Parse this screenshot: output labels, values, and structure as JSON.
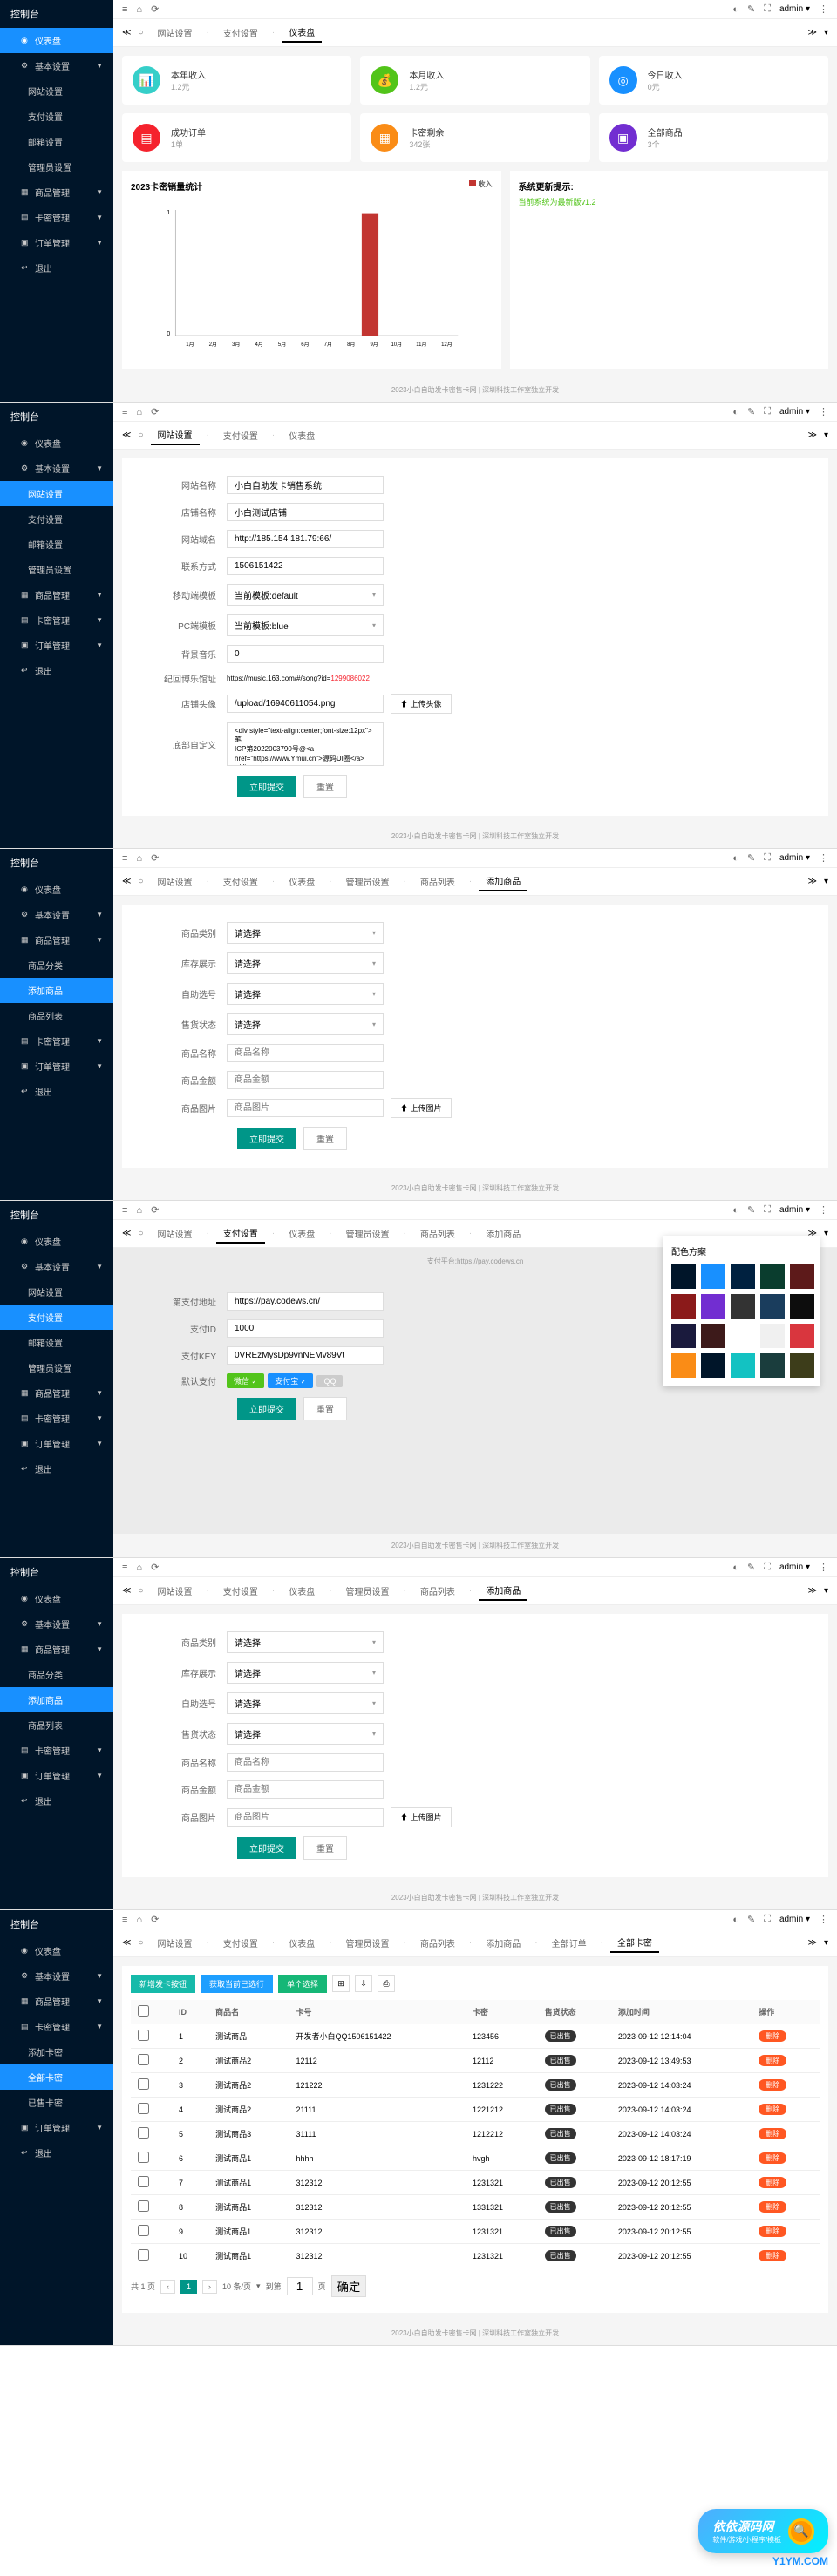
{
  "app_title": "控制台",
  "topbar": {
    "admin": "admin"
  },
  "sidebar": {
    "dashboard": "仪表盘",
    "basic_settings": "基本设置",
    "site_settings": "网站设置",
    "pay_settings": "支付设置",
    "mail_settings": "邮箱设置",
    "admin_settings": "管理员设置",
    "goods_mgmt": "商品管理",
    "goods_class": "商品分类",
    "add_goods": "添加商品",
    "goods_list": "商品列表",
    "card_mgmt": "卡密管理",
    "add_card": "添加卡密",
    "all_cards": "全部卡密",
    "sold_cards": "已售卡密",
    "order_mgmt": "订单管理",
    "logout": "退出"
  },
  "tabs": {
    "site": "网站设置",
    "pay": "支付设置",
    "dash": "仪表盘",
    "admin": "管理员设置",
    "goods": "商品列表",
    "add": "添加商品",
    "orders": "全部订单",
    "cards": "全部卡密"
  },
  "stats": {
    "year": {
      "label": "本年收入",
      "value": "1.2元"
    },
    "month": {
      "label": "本月收入",
      "value": "1.2元"
    },
    "today": {
      "label": "今日收入",
      "value": "0元"
    },
    "orders": {
      "label": "成功订单",
      "value": "1单"
    },
    "cards": {
      "label": "卡密剩余",
      "value": "342张"
    },
    "goods": {
      "label": "全部商品",
      "value": "3个"
    }
  },
  "chart": {
    "title": "2023卡密销量统计",
    "legend": "收入",
    "update_title": "系统更新提示:",
    "update_text": "当前系统为最新版v1.2"
  },
  "chart_data": {
    "type": "bar",
    "categories": [
      "1月",
      "2月",
      "3月",
      "4月",
      "5月",
      "6月",
      "7月",
      "8月",
      "9月",
      "10月",
      "11月",
      "12月"
    ],
    "values": [
      0,
      0,
      0,
      0,
      0,
      0,
      0,
      0,
      1.2,
      0,
      0,
      0
    ],
    "title": "2023卡密销量统计",
    "xlabel": "",
    "ylabel": "",
    "ylim": [
      0,
      1.2
    ]
  },
  "footer": "2023小白自助发卡密售卡网 | 深圳科技工作室独立开发",
  "site_form": {
    "site_name": {
      "label": "网站名称",
      "value": "小白自助发卡销售系统"
    },
    "store_name": {
      "label": "店铺名称",
      "value": "小白测试店铺"
    },
    "site_url": {
      "label": "网站域名",
      "value": "http://185.154.181.79:66/"
    },
    "contact": {
      "label": "联系方式",
      "value": "1506151422"
    },
    "mobile_tpl": {
      "label": "移动端模板",
      "value": "当前模板:default"
    },
    "pc_tpl": {
      "label": "PC端模板",
      "value": "当前模板:blue"
    },
    "bgm": {
      "label": "背景音乐",
      "value": "0"
    },
    "bgm_url": {
      "label": "纪回博乐馆址",
      "value": "https://music.163.com/#/song?id=",
      "suffix": "1299086022"
    },
    "avatar": {
      "label": "店铺头像",
      "value": "/upload/16940611054.png",
      "btn": "上传头像"
    },
    "footer_code": {
      "label": "底部自定义",
      "value": "<div style=\"text-align:center;font-size:12px\">笔\nICP第2022003790号@<a\nhref=\"https://www.Ymui.cn\">源码UI圈</a></div>"
    },
    "submit": "立即提交",
    "reset": "重置"
  },
  "goods_form": {
    "category": {
      "label": "商品类别",
      "placeholder": "请选择"
    },
    "stock": {
      "label": "库存展示",
      "placeholder": "请选择"
    },
    "auto": {
      "label": "自助选号",
      "placeholder": "请选择"
    },
    "status": {
      "label": "售货状态",
      "placeholder": "请选择"
    },
    "name": {
      "label": "商品名称",
      "placeholder": "商品名称"
    },
    "price": {
      "label": "商品金额",
      "placeholder": "商品金额"
    },
    "image": {
      "label": "商品图片",
      "placeholder": "商品图片",
      "btn": "上传图片"
    },
    "submit": "立即提交",
    "reset": "重置"
  },
  "pay_form": {
    "note": "支付平台:https://pay.codews.cn",
    "pay_url": {
      "label": "第支付地址",
      "value": "https://pay.codews.cn/"
    },
    "pay_id": {
      "label": "支付ID",
      "value": "1000"
    },
    "pay_key": {
      "label": "支付KEY",
      "value": "0VREzMysDp9vnNEMv89Vt"
    },
    "default": {
      "label": "默认支付",
      "wx": "微信",
      "zfb": "支付宝",
      "qq": "QQ"
    },
    "submit": "立即提交",
    "reset": "重置"
  },
  "theme": {
    "title": "配色方案",
    "colors": [
      "#001529",
      "#1890ff",
      "#002140",
      "#0a3d2e",
      "#5d1a1a",
      "#8b1a1a",
      "#722ed1",
      "#333",
      "#1a3d5d",
      "#0d0d0d",
      "#1a1a3d",
      "#3d1a1a",
      "#fff",
      "#f0f0f0",
      "#d9363e",
      "#fa8c16",
      "#001529",
      "#13c2c2",
      "#1a3d3d",
      "#3d3d1a"
    ]
  },
  "table": {
    "btns": {
      "add": "新增发卡按钮",
      "batch": "获取当前已选行",
      "custom": "单个选择"
    },
    "headers": {
      "id": "ID",
      "goods": "商品名",
      "card": "卡号",
      "pwd": "卡密",
      "status": "售货状态",
      "time": "添加时间",
      "action": "操作"
    },
    "status_sold": "已出售",
    "del": "删除",
    "rows": [
      {
        "id": "1",
        "goods": "测试商品",
        "card": "开发者小白QQ1506151422",
        "pwd": "123456",
        "time": "2023-09-12 12:14:04"
      },
      {
        "id": "2",
        "goods": "测试商品2",
        "card": "12112",
        "pwd": "12112",
        "time": "2023-09-12 13:49:53"
      },
      {
        "id": "3",
        "goods": "测试商品2",
        "card": "121222",
        "pwd": "1231222",
        "time": "2023-09-12 14:03:24"
      },
      {
        "id": "4",
        "goods": "测试商品2",
        "card": "21111",
        "pwd": "1221212",
        "time": "2023-09-12 14:03:24"
      },
      {
        "id": "5",
        "goods": "测试商品3",
        "card": "31111",
        "pwd": "1212212",
        "time": "2023-09-12 14:03:24"
      },
      {
        "id": "6",
        "goods": "测试商品1",
        "card": "hhhh",
        "pwd": "hvgh",
        "time": "2023-09-12 18:17:19"
      },
      {
        "id": "7",
        "goods": "测试商品1",
        "card": "312312",
        "pwd": "1231321",
        "time": "2023-09-12 20:12:55"
      },
      {
        "id": "8",
        "goods": "测试商品1",
        "card": "312312",
        "pwd": "1331321",
        "time": "2023-09-12 20:12:55"
      },
      {
        "id": "9",
        "goods": "测试商品1",
        "card": "312312",
        "pwd": "1231321",
        "time": "2023-09-12 20:12:55"
      },
      {
        "id": "10",
        "goods": "测试商品1",
        "card": "312312",
        "pwd": "1231321",
        "time": "2023-09-12 20:12:55"
      }
    ],
    "pager": {
      "total": "共 1 页",
      "pagesize": "10 条/页",
      "goto": "到第",
      "page": "页",
      "confirm": "确定"
    }
  },
  "watermark": {
    "title": "依依源码网",
    "sub": "软件/游戏/小程序/模板",
    "url": "Y1YM.COM"
  }
}
